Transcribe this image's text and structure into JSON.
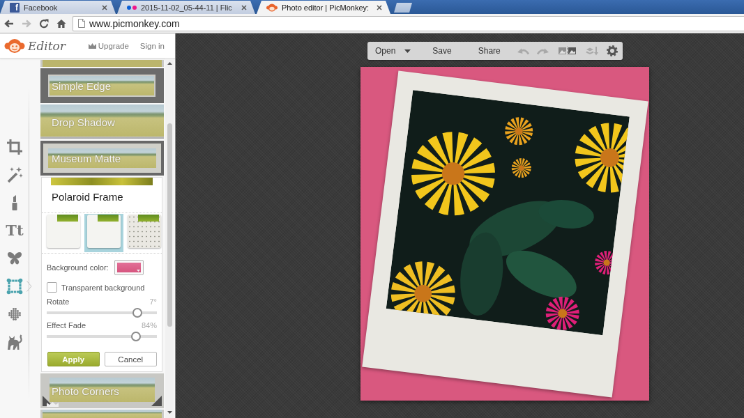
{
  "browser": {
    "tabs": [
      {
        "title": "Facebook",
        "kind": "letter",
        "icon_text": "f",
        "selected": false
      },
      {
        "title": "2015-11-02_05-44-11 | Flic",
        "kind": "dots",
        "selected": false
      },
      {
        "title": "Photo editor | PicMonkey:",
        "kind": "monkey",
        "selected": true
      }
    ],
    "nav": [
      {
        "kind": "back",
        "disabled": false
      },
      {
        "kind": "forward",
        "disabled": true
      },
      {
        "kind": "reload",
        "disabled": false
      },
      {
        "kind": "home",
        "disabled": false
      }
    ],
    "address": "www.picmonkey.com"
  },
  "header": {
    "logo_text": "Editor",
    "upgrade": "Upgrade",
    "sign_in": "Sign in"
  },
  "tools": [
    {
      "kind": "crop",
      "selected": false
    },
    {
      "kind": "wand",
      "selected": false
    },
    {
      "kind": "lipstick",
      "selected": false
    },
    {
      "kind": "text",
      "glyph": "Tt",
      "selected": false
    },
    {
      "kind": "butterfly",
      "selected": false
    },
    {
      "kind": "frame",
      "selected": true
    },
    {
      "kind": "texture",
      "selected": false
    },
    {
      "kind": "cat",
      "selected": false
    }
  ],
  "effects": [
    {
      "kind": "partial"
    },
    {
      "kind": "edge",
      "label": "Simple Edge",
      "premium": false
    },
    {
      "kind": "shadow",
      "label": "Drop Shadow",
      "premium": false
    },
    {
      "kind": "matte",
      "label": "Museum Matte",
      "premium": false
    },
    {
      "kind": "open",
      "title": "Polaroid Frame",
      "styles": [
        {
          "kind": "plain",
          "selected": false
        },
        {
          "kind": "plain",
          "selected": true
        },
        {
          "kind": "worn",
          "selected": false
        }
      ],
      "bg_color_label": "Background color:",
      "transparent": {
        "label": "Transparent background",
        "checked": false
      },
      "sliders": [
        {
          "label": "Rotate",
          "reading": "7°",
          "level": 0.82
        },
        {
          "label": "Effect Fade",
          "reading": "84%",
          "level": 0.81
        }
      ],
      "apply": "Apply",
      "cancel": "Cancel"
    },
    {
      "kind": "corners",
      "label": "Photo Corners",
      "premium": true
    },
    {
      "kind": "partial"
    }
  ],
  "toolbar": [
    {
      "kind": "menu",
      "label": "Open"
    },
    {
      "kind": "button",
      "label": "Save"
    },
    {
      "kind": "button",
      "label": "Share"
    },
    {
      "kind": "undo",
      "disabled": true
    },
    {
      "kind": "redo",
      "disabled": true
    },
    {
      "kind": "compare",
      "disabled": false
    },
    {
      "kind": "layers",
      "disabled": true
    },
    {
      "kind": "settings",
      "disabled": false
    }
  ]
}
